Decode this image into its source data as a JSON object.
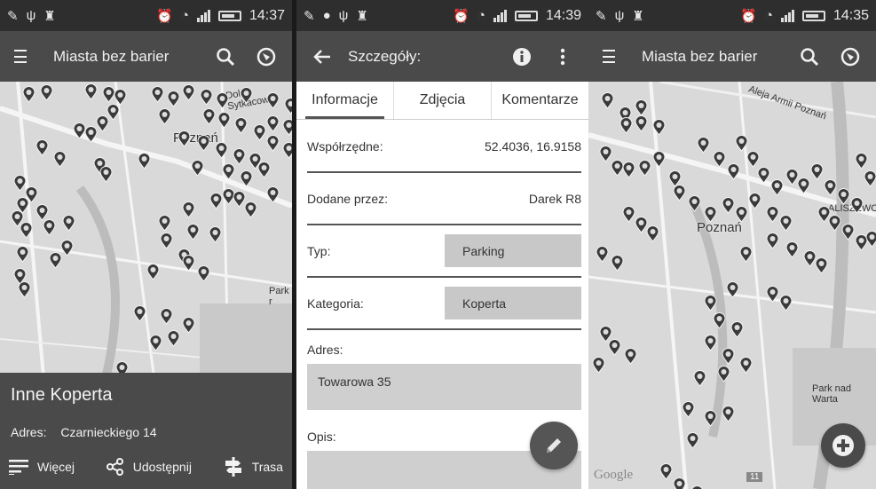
{
  "screens": [
    {
      "status": {
        "time": "14:37"
      },
      "appbar": {
        "title": "Miasta bez barier"
      },
      "map": {
        "labels": {
          "city": "Poznań",
          "street": "Dolna Sytkacowa",
          "park": "Park r"
        }
      },
      "info_panel": {
        "title": "Inne Koperta",
        "address_label": "Adres:",
        "address_value": "Czarnieckiego 14",
        "actions": {
          "more": "Więcej",
          "share": "Udostępnij",
          "route": "Trasa"
        }
      }
    },
    {
      "status": {
        "time": "14:39"
      },
      "appbar": {
        "title": "Szczegóły:"
      },
      "tabs": [
        "Informacje",
        "Zdjęcia",
        "Komentarze"
      ],
      "active_tab": "Informacje",
      "fields": {
        "coords_label": "Współrzędne:",
        "coords_value": "52.4036, 16.9158",
        "added_by_label": "Dodane przez:",
        "added_by_value": "Darek R8",
        "type_label": "Typ:",
        "type_value": "Parking",
        "category_label": "Kategoria:",
        "category_value": "Koperta",
        "address_label": "Adres:",
        "address_value": "Towarowa 35",
        "description_label": "Opis:",
        "description_value": ""
      }
    },
    {
      "status": {
        "time": "14:35"
      },
      "appbar": {
        "title": "Miasta bez barier"
      },
      "map": {
        "labels": {
          "city": "Poznań",
          "park": "Park nad Warta",
          "google": "Google",
          "district": "ALISZEWO",
          "street2": "Aleja Armii Poznań",
          "badge": "11"
        }
      }
    }
  ],
  "colors": {
    "bar": "#4a4a4a",
    "status": "#2e2e2e",
    "map": "#d7d7d7",
    "pin": "#3a3a3a"
  },
  "icons": [
    "menu-icon",
    "search-icon",
    "compass-icon",
    "back-arrow-icon",
    "info-icon",
    "overflow-icon",
    "pencil-icon",
    "plus-icon",
    "list-icon",
    "share-icon",
    "route-icon",
    "pin-icon"
  ]
}
